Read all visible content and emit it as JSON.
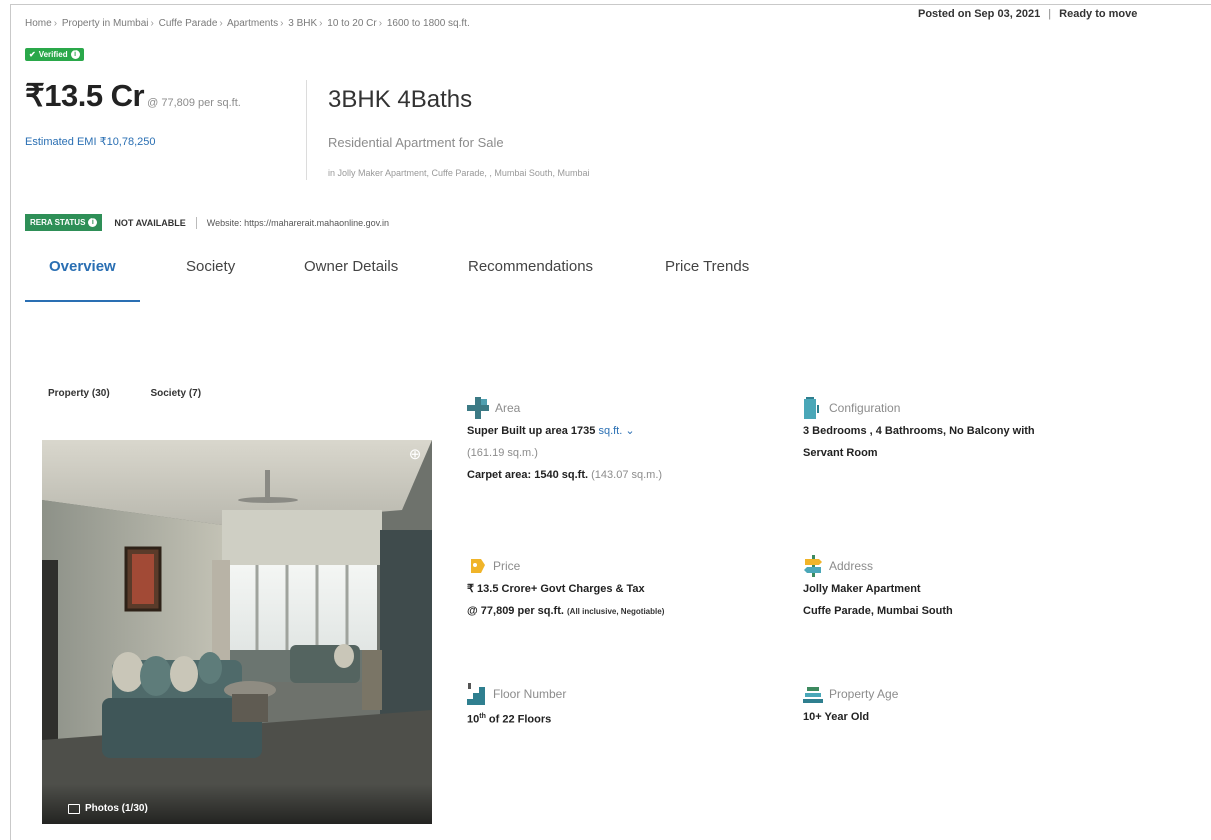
{
  "breadcrumb": [
    "Home",
    "Property in Mumbai",
    "Cuffe Parade",
    "Apartments",
    "3 BHK",
    "10 to 20 Cr",
    "1600 to 1800 sq.ft."
  ],
  "posted": {
    "date": "Posted on Sep 03, 2021",
    "status": "Ready to move"
  },
  "verified_label": "Verified",
  "price": {
    "amount": "₹13.5 Cr",
    "per_sqft": "@ 77,809 per sq.ft.",
    "emi": "Estimated EMI ₹10,78,250"
  },
  "listing": {
    "title": "3BHK 4Baths",
    "subtitle": "Residential Apartment for Sale",
    "location": "in Jolly Maker Apartment, Cuffe Parade, , Mumbai South, Mumbai"
  },
  "rera": {
    "label": "RERA STATUS",
    "status": "NOT AVAILABLE",
    "website": "Website: https://maharerait.mahaonline.gov.in"
  },
  "tabs": [
    {
      "label": "Overview",
      "active": true
    },
    {
      "label": "Society",
      "active": false
    },
    {
      "label": "Owner Details",
      "active": false
    },
    {
      "label": "Recommendations",
      "active": false
    },
    {
      "label": "Price Trends",
      "active": false
    }
  ],
  "photo_tabs": [
    "Property (30)",
    "Society (7)"
  ],
  "photo": {
    "counter": "Photos (1/30)",
    "zoom_icon": "zoom-in-icon"
  },
  "details": {
    "area": {
      "label": "Area",
      "super_built": "Super Built up area 1735",
      "unit": "sq.ft.",
      "super_sqm": "(161.19 sq.m.)",
      "carpet": "Carpet area: 1540 sq.ft.",
      "carpet_sqm": "(143.07 sq.m.)"
    },
    "configuration": {
      "label": "Configuration",
      "line1": "3 Bedrooms , 4 Bathrooms, No Balcony with",
      "line2": "Servant Room"
    },
    "price": {
      "label": "Price",
      "line1": "₹ 13.5 Crore+ Govt Charges & Tax",
      "line2": "@ 77,809 per sq.ft.",
      "note": "(All inclusive, Negotiable)"
    },
    "address": {
      "label": "Address",
      "line1": "Jolly Maker Apartment",
      "line2": "Cuffe Parade, Mumbai South"
    },
    "floor": {
      "label": "Floor Number",
      "floor_num": "10",
      "suffix": "th",
      "of_floors": "of 22 Floors"
    },
    "age": {
      "label": "Property Age",
      "value": "10+ Year Old"
    }
  },
  "colors": {
    "accent": "#2a6fb3",
    "verified": "#2aa84a",
    "rera": "#2e8f57"
  }
}
